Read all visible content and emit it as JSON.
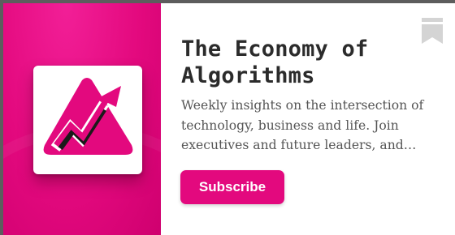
{
  "publication": {
    "title": "The Economy of Algorithms",
    "description": "Weekly insights on the intersection of technology, business and life. Join executives and future leaders, and…",
    "logo": "mountain-arrow-logo"
  },
  "actions": {
    "subscribe_label": "Subscribe",
    "bookmark_icon": "bookmark-icon"
  },
  "colors": {
    "brand": "#e3097e",
    "title_text": "#2b2b2b",
    "body_text": "#555555",
    "bookmark": "#d4d4d4"
  }
}
